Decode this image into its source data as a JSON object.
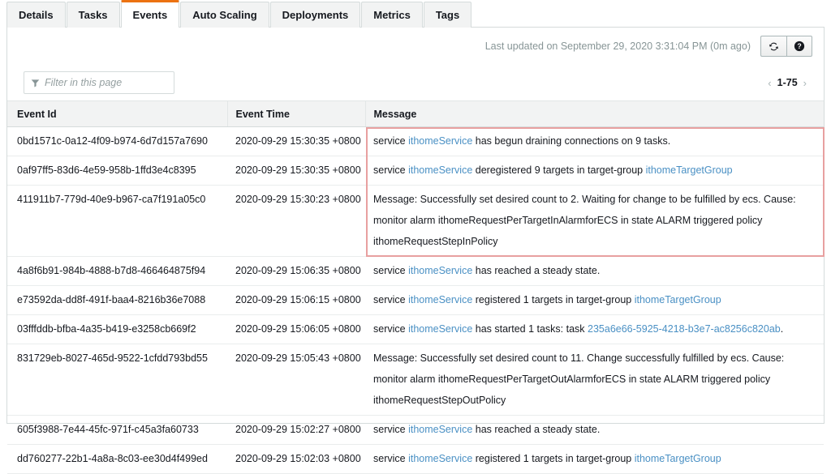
{
  "tabs": [
    {
      "label": "Details",
      "active": false
    },
    {
      "label": "Tasks",
      "active": false
    },
    {
      "label": "Events",
      "active": true
    },
    {
      "label": "Auto Scaling",
      "active": false
    },
    {
      "label": "Deployments",
      "active": false
    },
    {
      "label": "Metrics",
      "active": false
    },
    {
      "label": "Tags",
      "active": false
    }
  ],
  "toolbar": {
    "last_updated": "Last updated on September 29, 2020 3:31:04 PM (0m ago)",
    "refresh_icon": "refresh-icon",
    "help_icon": "help-icon"
  },
  "filter": {
    "placeholder": "Filter in this page",
    "value": "",
    "icon": "funnel-icon"
  },
  "pagination": {
    "prev_icon": "chevron-left-icon",
    "range": "1-75",
    "next_icon": "chevron-right-icon"
  },
  "table": {
    "columns": [
      "Event Id",
      "Event Time",
      "Message"
    ],
    "rows": [
      {
        "event_id": "0bd1571c-0a12-4f09-b974-6d7d157a7690",
        "event_time": "2020-09-29 15:30:35 +0800",
        "message_parts": [
          [
            {
              "t": "service ",
              "link": false
            },
            {
              "t": "ithomeService",
              "link": true
            },
            {
              "t": " has begun draining connections on 9 tasks.",
              "link": false
            }
          ]
        ]
      },
      {
        "event_id": "0af97ff5-83d6-4e59-958b-1ffd3e4c8395",
        "event_time": "2020-09-29 15:30:35 +0800",
        "message_parts": [
          [
            {
              "t": "service ",
              "link": false
            },
            {
              "t": "ithomeService",
              "link": true
            },
            {
              "t": " deregistered 9 targets in target-group ",
              "link": false
            },
            {
              "t": "ithomeTargetGroup",
              "link": true
            }
          ]
        ]
      },
      {
        "event_id": "411911b7-779d-40e9-b967-ca7f191a05c0",
        "event_time": "2020-09-29 15:30:23 +0800",
        "tall": true,
        "message_parts": [
          [
            {
              "t": "Message: Successfully set desired count to 2. Waiting for change to be fulfilled by ecs. Cause:",
              "link": false
            }
          ],
          [
            {
              "t": "monitor alarm ithomeRequestPerTargetInAlarmforECS in state ALARM triggered policy",
              "link": false
            }
          ],
          [
            {
              "t": "ithomeRequestStepInPolicy",
              "link": false
            }
          ]
        ]
      },
      {
        "event_id": "4a8f6b91-984b-4888-b7d8-466464875f94",
        "event_time": "2020-09-29 15:06:35 +0800",
        "message_parts": [
          [
            {
              "t": "service ",
              "link": false
            },
            {
              "t": "ithomeService",
              "link": true
            },
            {
              "t": " has reached a steady state.",
              "link": false
            }
          ]
        ]
      },
      {
        "event_id": "e73592da-dd8f-491f-baa4-8216b36e7088",
        "event_time": "2020-09-29 15:06:15 +0800",
        "message_parts": [
          [
            {
              "t": "service ",
              "link": false
            },
            {
              "t": "ithomeService",
              "link": true
            },
            {
              "t": " registered 1 targets in target-group ",
              "link": false
            },
            {
              "t": "ithomeTargetGroup",
              "link": true
            }
          ]
        ]
      },
      {
        "event_id": "03fffddb-bfba-4a35-b419-e3258cb669f2",
        "event_time": "2020-09-29 15:06:05 +0800",
        "message_parts": [
          [
            {
              "t": "service ",
              "link": false
            },
            {
              "t": "ithomeService",
              "link": true
            },
            {
              "t": " has started 1 tasks: task ",
              "link": false
            },
            {
              "t": "235a6e66-5925-4218-b3e7-ac8256c820ab",
              "link": true
            },
            {
              "t": ".",
              "link": false
            }
          ]
        ]
      },
      {
        "event_id": "831729eb-8027-465d-9522-1cfdd793bd55",
        "event_time": "2020-09-29 15:05:43 +0800",
        "tall": true,
        "message_parts": [
          [
            {
              "t": "Message: Successfully set desired count to 11. Change successfully fulfilled by ecs. Cause:",
              "link": false
            }
          ],
          [
            {
              "t": "monitor alarm ithomeRequestPerTargetOutAlarmforECS in state ALARM triggered policy",
              "link": false
            }
          ],
          [
            {
              "t": "ithomeRequestStepOutPolicy",
              "link": false
            }
          ]
        ]
      },
      {
        "event_id": "605f3988-7e44-45fc-971f-c45a3fa60733",
        "event_time": "2020-09-29 15:02:27 +0800",
        "message_parts": [
          [
            {
              "t": "service ",
              "link": false
            },
            {
              "t": "ithomeService",
              "link": true
            },
            {
              "t": " has reached a steady state.",
              "link": false
            }
          ]
        ]
      },
      {
        "event_id": "dd760277-22b1-4a8a-8c03-ee30d4f499ed",
        "event_time": "2020-09-29 15:02:03 +0800",
        "message_parts": [
          [
            {
              "t": "service ",
              "link": false
            },
            {
              "t": "ithomeService",
              "link": true
            },
            {
              "t": " registered 1 targets in target-group ",
              "link": false
            },
            {
              "t": "ithomeTargetGroup",
              "link": true
            }
          ]
        ]
      }
    ]
  },
  "annotation": {
    "highlight_color": "#e8a0a0",
    "covers_rows": [
      0,
      1,
      2
    ]
  },
  "colors": {
    "accent": "#ec7211",
    "link": "#4a90c4",
    "header_bg": "#f2f3f3",
    "border": "#d5dbdb"
  }
}
